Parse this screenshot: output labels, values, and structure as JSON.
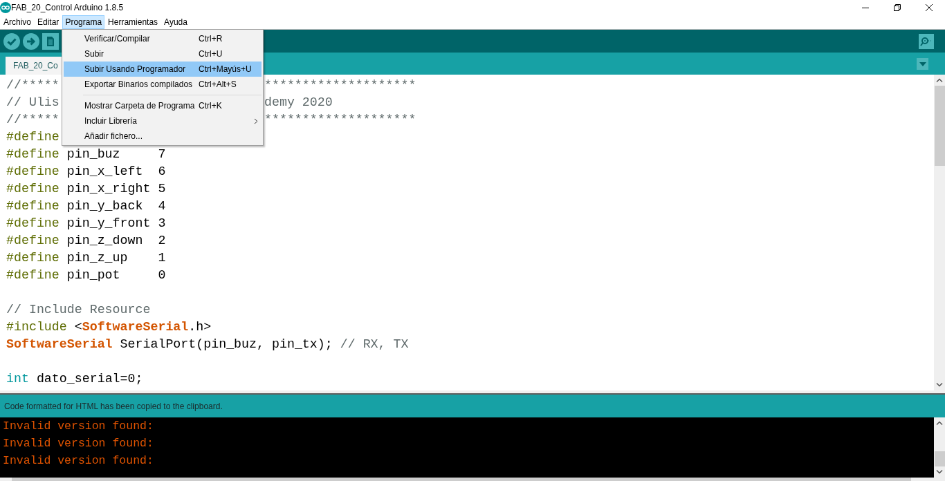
{
  "window": {
    "title": "FAB_20_Control Arduino 1.8.5"
  },
  "menubar": [
    {
      "label": "Archivo",
      "selected": false
    },
    {
      "label": "Editar",
      "selected": false
    },
    {
      "label": "Programa",
      "selected": true
    },
    {
      "label": "Herramientas",
      "selected": false
    },
    {
      "label": "Ayuda",
      "selected": false
    }
  ],
  "menu": {
    "items": [
      {
        "kind": "item",
        "label": "Verificar/Compilar",
        "shortcut": "Ctrl+R",
        "selected": false
      },
      {
        "kind": "item",
        "label": "Subir",
        "shortcut": "Ctrl+U",
        "selected": false
      },
      {
        "kind": "item",
        "label": "Subir Usando Programador",
        "shortcut": "Ctrl+Mayús+U",
        "selected": true
      },
      {
        "kind": "item",
        "label": "Exportar Binarios compilados",
        "shortcut": "Ctrl+Alt+S",
        "selected": false
      },
      {
        "kind": "separator"
      },
      {
        "kind": "item",
        "label": "Mostrar Carpeta de Programa",
        "shortcut": "Ctrl+K",
        "selected": false
      },
      {
        "kind": "submenu",
        "label": "Incluir Librería",
        "selected": false
      },
      {
        "kind": "item",
        "label": "Añadir fichero...",
        "selected": false
      }
    ]
  },
  "tabs": [
    {
      "label": "FAB_20_Co",
      "selected": true
    }
  ],
  "editor": {
    "lines": [
      {
        "kind": "split",
        "left": [
          {
            "kind": "comment",
            "text": "//*****"
          }
        ],
        "right": [
          {
            "kind": "comment",
            "text": "********************"
          }
        ]
      },
      {
        "kind": "split",
        "left": [
          {
            "kind": "comment",
            "text": "// Ulis"
          }
        ],
        "right": [
          {
            "kind": "comment",
            "text": "demy 2020"
          }
        ]
      },
      {
        "kind": "split",
        "left": [
          {
            "kind": "comment",
            "text": "//*****"
          }
        ],
        "right": [
          {
            "kind": "comment",
            "text": "********************"
          }
        ]
      },
      {
        "kind": "split",
        "left": [
          {
            "kind": "directive",
            "text": "#define"
          }
        ]
      },
      {
        "kind": "code",
        "tokens": [
          {
            "kind": "directive",
            "text": "#define"
          },
          {
            "kind": "plain",
            "text": " pin_buz     7"
          }
        ]
      },
      {
        "kind": "code",
        "tokens": [
          {
            "kind": "directive",
            "text": "#define"
          },
          {
            "kind": "plain",
            "text": " pin_x_left  6"
          }
        ]
      },
      {
        "kind": "code",
        "tokens": [
          {
            "kind": "directive",
            "text": "#define"
          },
          {
            "kind": "plain",
            "text": " pin_x_right 5"
          }
        ]
      },
      {
        "kind": "code",
        "tokens": [
          {
            "kind": "directive",
            "text": "#define"
          },
          {
            "kind": "plain",
            "text": " pin_y_back  4"
          }
        ]
      },
      {
        "kind": "code",
        "tokens": [
          {
            "kind": "directive",
            "text": "#define"
          },
          {
            "kind": "plain",
            "text": " pin_y_front 3"
          }
        ]
      },
      {
        "kind": "code",
        "tokens": [
          {
            "kind": "directive",
            "text": "#define"
          },
          {
            "kind": "plain",
            "text": " pin_z_down  2"
          }
        ]
      },
      {
        "kind": "code",
        "tokens": [
          {
            "kind": "directive",
            "text": "#define"
          },
          {
            "kind": "plain",
            "text": " pin_z_up    1"
          }
        ]
      },
      {
        "kind": "code",
        "tokens": [
          {
            "kind": "directive",
            "text": "#define"
          },
          {
            "kind": "plain",
            "text": " pin_pot     0"
          }
        ]
      },
      {
        "kind": "blank"
      },
      {
        "kind": "code",
        "tokens": [
          {
            "kind": "comment",
            "text": "// Include Resource"
          }
        ]
      },
      {
        "kind": "code",
        "tokens": [
          {
            "kind": "directive",
            "text": "#include"
          },
          {
            "kind": "plain",
            "text": " <"
          },
          {
            "kind": "class",
            "text": "SoftwareSerial"
          },
          {
            "kind": "plain",
            "text": ".h>"
          }
        ]
      },
      {
        "kind": "code",
        "tokens": [
          {
            "kind": "class",
            "text": "SoftwareSerial"
          },
          {
            "kind": "plain",
            "text": " SerialPort(pin_buz, pin_tx); "
          },
          {
            "kind": "comment",
            "text": "// RX, TX"
          }
        ]
      },
      {
        "kind": "blank"
      },
      {
        "kind": "code",
        "tokens": [
          {
            "kind": "type",
            "text": "int"
          },
          {
            "kind": "plain",
            "text": " dato_serial=0;"
          }
        ]
      }
    ]
  },
  "status_bar": {
    "message": "Code formatted for HTML has been copied to the clipboard."
  },
  "console": {
    "lines": [
      "Invalid version found:",
      "Invalid version found:",
      "Invalid version found:"
    ]
  }
}
